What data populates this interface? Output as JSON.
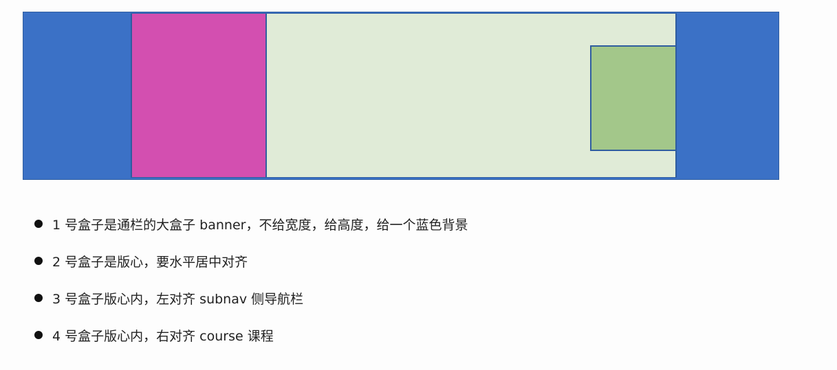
{
  "diagram": {
    "boxes": [
      {
        "id": "1",
        "role": "banner",
        "color": "#3b71c6"
      },
      {
        "id": "2",
        "role": "center",
        "color": "#e0ebd7"
      },
      {
        "id": "3",
        "role": "subnav",
        "color": "#d34fb0"
      },
      {
        "id": "4",
        "role": "course",
        "color": "#a3c78a"
      }
    ],
    "border_color": "#2f5d9f"
  },
  "notes": [
    "1 号盒子是通栏的大盒子 banner，不给宽度，给高度，给一个蓝色背景",
    "2 号盒子是版心，要水平居中对齐",
    "3 号盒子版心内，左对齐 subnav 侧导航栏",
    "4 号盒子版心内，右对齐  course 课程"
  ]
}
